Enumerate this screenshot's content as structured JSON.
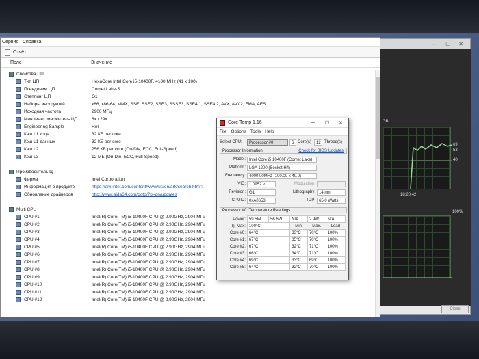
{
  "aida": {
    "menu": [
      "Сервис",
      "Справка"
    ],
    "toolbar": {
      "report_label": "Отчёт"
    },
    "columns": {
      "field": "Поле",
      "value": "Значение"
    },
    "rows": [
      {
        "type": "group",
        "name": "Свойства ЦП",
        "value": ""
      },
      {
        "type": "item",
        "name": "Тип ЦП",
        "value": "HexaCore Intel Core i5-10400F, 4100 MHz (41 x 100)"
      },
      {
        "type": "item",
        "name": "Псевдоним ЦП",
        "value": "Comet Lake-S"
      },
      {
        "type": "item",
        "name": "Степпинг ЦП",
        "value": "G1"
      },
      {
        "type": "item",
        "name": "Наборы инструкций",
        "value": "x86, x86-64, MMX, SSE, SSE2, SSE3, SSSE3, SSE4.1, SSE4.2, AVX, AVX2, FMA, AES"
      },
      {
        "type": "item",
        "name": "Исходная частота",
        "value": "2900 МГц"
      },
      {
        "type": "item",
        "name": "Мин./макс. множитель ЦП",
        "value": "8x / 29x"
      },
      {
        "type": "item",
        "name": "Engineering Sample",
        "value": "Нет"
      },
      {
        "type": "item",
        "name": "Кэш L1 кода",
        "value": "32 КБ per core"
      },
      {
        "type": "item",
        "name": "Кэш L1 данных",
        "value": "32 КБ per core"
      },
      {
        "type": "item",
        "name": "Кэш L2",
        "value": "256 КБ per core  (On-Die, ECC, Full-Speed)"
      },
      {
        "type": "item",
        "name": "Кэш L3",
        "value": "12 МБ  (On-Die, ECC, Full-Speed)"
      },
      {
        "type": "blank",
        "name": "",
        "value": ""
      },
      {
        "type": "group",
        "name": "Производитель ЦП",
        "value": ""
      },
      {
        "type": "item",
        "name": "Фирма",
        "value": "Intel Corporation"
      },
      {
        "type": "link",
        "name": "Информация о продукте",
        "value": "https://ark.intel.com/content/www/us/en/ark/search.html?"
      },
      {
        "type": "link",
        "name": "Обновление драйверов",
        "value": "http://www.aida64.com/goto/?p=drvupdates"
      },
      {
        "type": "blank",
        "name": "",
        "value": ""
      },
      {
        "type": "group",
        "name": "Multi CPU",
        "value": ""
      },
      {
        "type": "item",
        "name": "CPU #1",
        "value": "Intel(R) Core(TM) i5-10400F CPU @ 2.90GHz, 2904 МГц"
      },
      {
        "type": "item",
        "name": "CPU #2",
        "value": "Intel(R) Core(TM) i5-10400F CPU @ 2.90GHz, 2904 МГц"
      },
      {
        "type": "item",
        "name": "CPU #3",
        "value": "Intel(R) Core(TM) i5-10400F CPU @ 2.90GHz, 2904 МГц"
      },
      {
        "type": "item",
        "name": "CPU #4",
        "value": "Intel(R) Core(TM) i5-10400F CPU @ 2.90GHz, 2904 МГц"
      },
      {
        "type": "item",
        "name": "CPU #5",
        "value": "Intel(R) Core(TM) i5-10400F CPU @ 2.90GHz, 2904 МГц"
      },
      {
        "type": "item",
        "name": "CPU #6",
        "value": "Intel(R) Core(TM) i5-10400F CPU @ 2.90GHz, 2904 МГц"
      },
      {
        "type": "item",
        "name": "CPU #7",
        "value": "Intel(R) Core(TM) i5-10400F CPU @ 2.90GHz, 2904 МГц"
      },
      {
        "type": "item",
        "name": "CPU #8",
        "value": "Intel(R) Core(TM) i5-10400F CPU @ 2.90GHz, 2904 МГц"
      },
      {
        "type": "item",
        "name": "CPU #9",
        "value": "Intel(R) Core(TM) i5-10400F CPU @ 2.90GHz, 2904 МГц"
      },
      {
        "type": "item",
        "name": "CPU #10",
        "value": "Intel(R) Core(TM) i5-10400F CPU @ 2.90GHz, 2904 МГц"
      },
      {
        "type": "item",
        "name": "CPU #11",
        "value": "Intel(R) Core(TM) i5-10400F CPU @ 2.90GHz, 2904 МГц"
      },
      {
        "type": "item",
        "name": "CPU #12",
        "value": "Intel(R) Core(TM) i5-10400F CPU @ 2.90GHz, 2904 МГц"
      }
    ]
  },
  "coretemp": {
    "title": "Core Temp 1.16",
    "menu": [
      "File",
      "Options",
      "Tools",
      "Help"
    ],
    "select_cpu_label": "Select CPU:",
    "processor_select": "Processor #0",
    "cores_value": "6",
    "cores_label": "Core(s)",
    "threads_value": "12",
    "threads_label": "Thread(s)",
    "info_header": "Processor Information",
    "bios_link": "Check for BIOS Updates",
    "model_label": "Model:",
    "model": "Intel Core i5 10400F (Comet Lake)",
    "platform_label": "Platform:",
    "platform": "LGA 1200 (Socket H4)",
    "frequency_label": "Frequency:",
    "frequency": "4000.00MHz (100.00 x 40.0)",
    "vid_label": "VID:",
    "vid": "1.0952 v",
    "modulation_label": "Modulation:",
    "revision_label": "Revision:",
    "revision": "G1",
    "lithography_label": "Lithography:",
    "lithography": "14 nm",
    "cpuid_label": "CPUID:",
    "cpuid": "0xA0653",
    "tdp_label": "TDP:",
    "tdp": "65.0 Watts",
    "temps_header": "Processor #0: Temperature Readings",
    "power_label": "Power:",
    "power": [
      "59.5W",
      "56.6W",
      "N/A",
      "2.9W",
      "N/A"
    ],
    "tjmax_label": "Tj. Max:",
    "tjmax": "100°C",
    "col_min": "Min.",
    "col_max": "Max.",
    "col_load": "Load",
    "cores": [
      {
        "label": "Core #0:",
        "temp": "64°C",
        "min": "33°C",
        "max": "70°C",
        "load": "100%"
      },
      {
        "label": "Core #1:",
        "temp": "67°C",
        "min": "35°C",
        "max": "70°C",
        "load": "100%"
      },
      {
        "label": "Core #2:",
        "temp": "67°C",
        "min": "32°C",
        "max": "71°C",
        "load": "100%"
      },
      {
        "label": "Core #3:",
        "temp": "66°C",
        "min": "34°C",
        "max": "71°C",
        "load": "100%"
      },
      {
        "label": "Core #4:",
        "temp": "69°C",
        "min": "33°C",
        "max": "69°C",
        "load": "100%"
      },
      {
        "label": "Core #5:",
        "temp": "64°C",
        "min": "32°C",
        "max": "70°C",
        "load": "100%"
      }
    ]
  },
  "taskmgr": {
    "label_top": "GB",
    "graph_values": [
      "69",
      "53",
      "40"
    ],
    "time": "18:20:42",
    "pct": "100%",
    "close_label": "Close"
  }
}
